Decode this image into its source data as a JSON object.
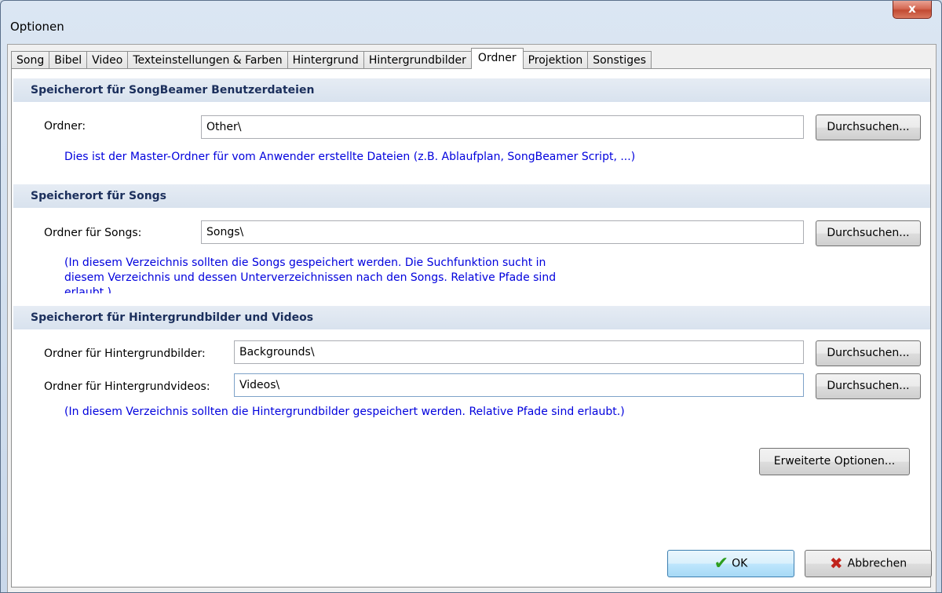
{
  "window": {
    "title": "Optionen",
    "close_glyph": "x"
  },
  "tabs": [
    {
      "label": "Song"
    },
    {
      "label": "Bibel"
    },
    {
      "label": "Video"
    },
    {
      "label": "Texteinstellungen & Farben"
    },
    {
      "label": "Hintergrund"
    },
    {
      "label": "Hintergrundbilder"
    },
    {
      "label": "Ordner"
    },
    {
      "label": "Projektion"
    },
    {
      "label": "Sonstiges"
    }
  ],
  "active_tab": "Ordner",
  "sections": {
    "user_files": {
      "header": "Speicherort für SongBeamer Benutzerdateien",
      "folder_label": "Ordner:",
      "folder_value": "Other\\",
      "browse_label": "Durchsuchen...",
      "note": "Dies ist der Master-Ordner für vom Anwender erstellte Dateien (z.B. Ablaufplan, SongBeamer Script, ...)"
    },
    "songs": {
      "header": "Speicherort für Songs",
      "folder_label": "Ordner für Songs:",
      "folder_value": "Songs\\",
      "browse_label": "Durchsuchen...",
      "note_line1": "(In diesem Verzeichnis sollten die Songs gespeichert werden. Die Suchfunktion sucht in",
      "note_line2": "diesem Verzeichnis und dessen Unterverzeichnissen nach den Songs. Relative Pfade sind",
      "note_line3": "erlaubt.)"
    },
    "backgrounds": {
      "header": "Speicherort für Hintergrundbilder und Videos",
      "images_label": "Ordner für Hintergrundbilder:",
      "images_value": "Backgrounds\\",
      "videos_label": "Ordner für Hintergrundvideos:",
      "videos_value": "Videos\\",
      "browse_label": "Durchsuchen...",
      "note": "(In diesem Verzeichnis sollten die Hintergrundbilder gespeichert werden. Relative Pfade sind erlaubt.)"
    }
  },
  "buttons": {
    "advanced": "Erweiterte Optionen...",
    "ok": "OK",
    "cancel": "Abbrechen"
  },
  "icons": {
    "ok": "checkmark-icon",
    "cancel": "x-cross-icon"
  },
  "colors": {
    "note_text": "#0000dd",
    "section_header_text": "#1b2f5c",
    "ok_icon": "#2e9e1e",
    "cancel_icon": "#c0231b"
  }
}
